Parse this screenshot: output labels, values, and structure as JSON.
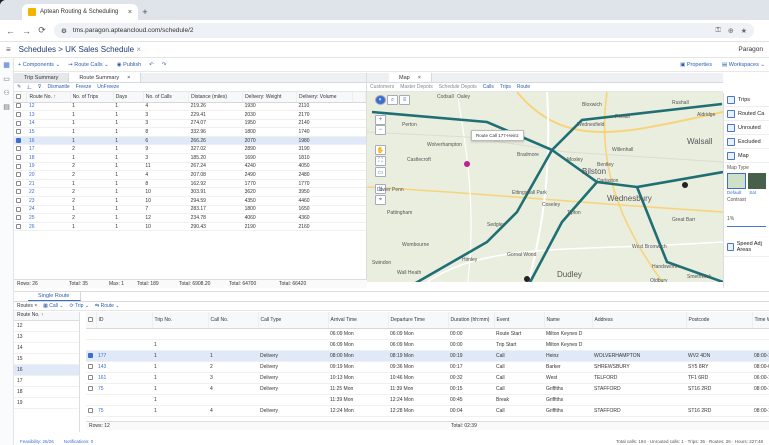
{
  "browser": {
    "tab_title": "Aptean Routing & Scheduling",
    "url": "tms.paragon.apteancloud.com/schedule/2"
  },
  "app": {
    "breadcrumb_root": "Schedules",
    "breadcrumb_sep": ">",
    "schedule_title": "UK Sales Schedule",
    "right_label": "Paragon"
  },
  "toolbar": {
    "components": "Components",
    "route_calls": "Route Calls",
    "publish": "Publish",
    "properties": "Properties",
    "workspaces": "Workspaces"
  },
  "route_summary": {
    "tabs": [
      "Trip Summary",
      "Route Summary"
    ],
    "actions": [
      "Dismantle",
      "Freeze",
      "UnFreeze"
    ],
    "columns": [
      "Route No.",
      "No. of Trips",
      "Days",
      "No. of Calls",
      "Distance (miles)",
      "Delivery: Weight",
      "Delivery: Volume"
    ],
    "rows": [
      [
        "12",
        "1",
        "1",
        "4",
        "219.26",
        "1930",
        "2110",
        false
      ],
      [
        "13",
        "1",
        "1",
        "3",
        "229.41",
        "2030",
        "2170",
        false
      ],
      [
        "14",
        "1",
        "1",
        "3",
        "274.07",
        "1950",
        "2140",
        false
      ],
      [
        "15",
        "1",
        "1",
        "8",
        "332.96",
        "1800",
        "1740",
        false
      ],
      [
        "16",
        "1",
        "1",
        "6",
        "266.26",
        "2070",
        "1980",
        true
      ],
      [
        "17",
        "2",
        "1",
        "9",
        "327.02",
        "2890",
        "3190",
        false
      ],
      [
        "18",
        "1",
        "1",
        "3",
        "185.20",
        "1690",
        "1810",
        false
      ],
      [
        "19",
        "2",
        "1",
        "11",
        "267.24",
        "4240",
        "4050",
        false
      ],
      [
        "20",
        "2",
        "1",
        "4",
        "207.08",
        "2490",
        "2480",
        false
      ],
      [
        "21",
        "1",
        "1",
        "8",
        "162.92",
        "1770",
        "1770",
        false
      ],
      [
        "22",
        "2",
        "1",
        "10",
        "303.91",
        "3620",
        "3950",
        false
      ],
      [
        "23",
        "2",
        "1",
        "10",
        "294.59",
        "4350",
        "4460",
        false
      ],
      [
        "24",
        "1",
        "1",
        "7",
        "283.17",
        "1800",
        "1650",
        false
      ],
      [
        "25",
        "2",
        "1",
        "12",
        "234.78",
        "4060",
        "4360",
        false
      ],
      [
        "26",
        "1",
        "1",
        "10",
        "290.43",
        "2190",
        "2160",
        false
      ]
    ],
    "footer": [
      "Rows: 26",
      "Total: 35",
      "Max: 1",
      "Total: 189",
      "Total: 6908.20",
      "Total: 64700",
      "Total: 66420"
    ]
  },
  "map": {
    "tab": "Map",
    "filters": [
      "Customers",
      "Master Depots",
      "Schedule Depots",
      "Calls",
      "Trips",
      "Route"
    ],
    "tooltip": "Route Call 177-Heinz",
    "places": [
      {
        "name": "Oaley"
      },
      {
        "name": "Bloxwich"
      },
      {
        "name": "Pelsall"
      },
      {
        "name": "Rushall"
      },
      {
        "name": "Aldridge"
      },
      {
        "name": "Perton"
      },
      {
        "name": "Wednesfield"
      },
      {
        "name": "Walsall"
      },
      {
        "name": "Willenhall"
      },
      {
        "name": "Bradmore"
      },
      {
        "name": "Bilston"
      },
      {
        "name": "Darlaston"
      },
      {
        "name": "Wednesbury"
      },
      {
        "name": "Sedgley"
      },
      {
        "name": "Tipton"
      },
      {
        "name": "Dudley"
      },
      {
        "name": "Oldbury"
      },
      {
        "name": "West Bromwich"
      },
      {
        "name": "Wombourne"
      },
      {
        "name": "Gornal Wood"
      },
      {
        "name": "Ettingshall Park"
      },
      {
        "name": "Castlecroft"
      },
      {
        "name": "Lower Penn"
      },
      {
        "name": "Wall Heath"
      },
      {
        "name": "Swindon"
      },
      {
        "name": "Coseley"
      },
      {
        "name": "Great Barr"
      },
      {
        "name": "Handsworth"
      },
      {
        "name": "Wolverhampton"
      },
      {
        "name": "Smethwick"
      },
      {
        "name": "Himley"
      },
      {
        "name": "Moxley"
      },
      {
        "name": "Bentley"
      },
      {
        "name": "Codsall"
      },
      {
        "name": "Pattingham"
      }
    ]
  },
  "map_panel": {
    "items": [
      "Trips",
      "Routed Ca",
      "Unrouted",
      "Excluded",
      "Map"
    ],
    "map_type_label": "Map Type",
    "map_types": [
      "Default",
      "Sat"
    ],
    "contrast_label": "Contrast",
    "percent": "1%",
    "speed_label": "Speed Adj Areas"
  },
  "single_route": {
    "tab": "Single Route",
    "sub_tabs": [
      "Routes",
      "Call",
      "Trip",
      "Route"
    ],
    "route_col": "Route No.",
    "route_list": [
      "12",
      "13",
      "14",
      "15",
      "16",
      "17",
      "18",
      "19"
    ],
    "columns": [
      "ID",
      "Trip No.",
      "Call No.",
      "Call Type",
      "Arrival Time",
      "Departure Time",
      "Duration (hh:mm)",
      "Event",
      "Name",
      "Address",
      "Postcode",
      "Time Window"
    ],
    "rows": [
      [
        "",
        "",
        "",
        "",
        "06:09 Mon",
        "06:09 Mon",
        "00:00",
        "Route Start",
        "Milton Keynes D",
        "",
        "",
        ""
      ],
      [
        "",
        "1",
        "",
        "",
        "06:09 Mon",
        "06:09 Mon",
        "00:00",
        "Trip Start",
        "Milton Keynes D",
        "",
        "",
        ""
      ],
      [
        "177",
        "1",
        "1",
        "Delivery",
        "08:00 Mon",
        "08:19 Mon",
        "00:19",
        "Call",
        "Heinz",
        "WOLVERHAMPTON",
        "WV2 4DN",
        "08:00-18:00"
      ],
      [
        "143",
        "1",
        "2",
        "Delivery",
        "09:19 Mon",
        "09:36 Mon",
        "00:17",
        "Call",
        "Barker",
        "SHREWSBURY",
        "SY5 8RY",
        "08:00-09:30"
      ],
      [
        "161",
        "1",
        "3",
        "Delivery",
        "10:13 Mon",
        "10:46 Mon",
        "00:32",
        "Call",
        "West",
        "TELFORD",
        "TF1 6RD",
        "06:00-11:00"
      ],
      [
        "75",
        "1",
        "4",
        "Delivery",
        "11:25 Mon",
        "11:39 Mon",
        "00:15",
        "Call",
        "Griffiths",
        "STAFFORD",
        "ST16 2RD",
        "08:00-18:00"
      ],
      [
        "",
        "1",
        "",
        "",
        "11:39 Mon",
        "12:24 Mon",
        "00:45",
        "Break",
        "Griffiths",
        "",
        "",
        ""
      ],
      [
        "75",
        "1",
        "4",
        "Delivery",
        "12:24 Mon",
        "12:28 Mon",
        "00:04",
        "Call",
        "Griffiths",
        "STAFFORD",
        "ST16 2RD",
        "08:00-18:00"
      ]
    ],
    "footer_rows": "Rows: 12",
    "footer_total": "Total: 02:39"
  },
  "status": {
    "feasibility": "Feasibility: 26/26",
    "notifications": "Notifications: 0",
    "right": "Total calls: 194 · Unrouted calls: 1 · Trips: 35 · Routes: 26 · Hours: 227:48"
  }
}
